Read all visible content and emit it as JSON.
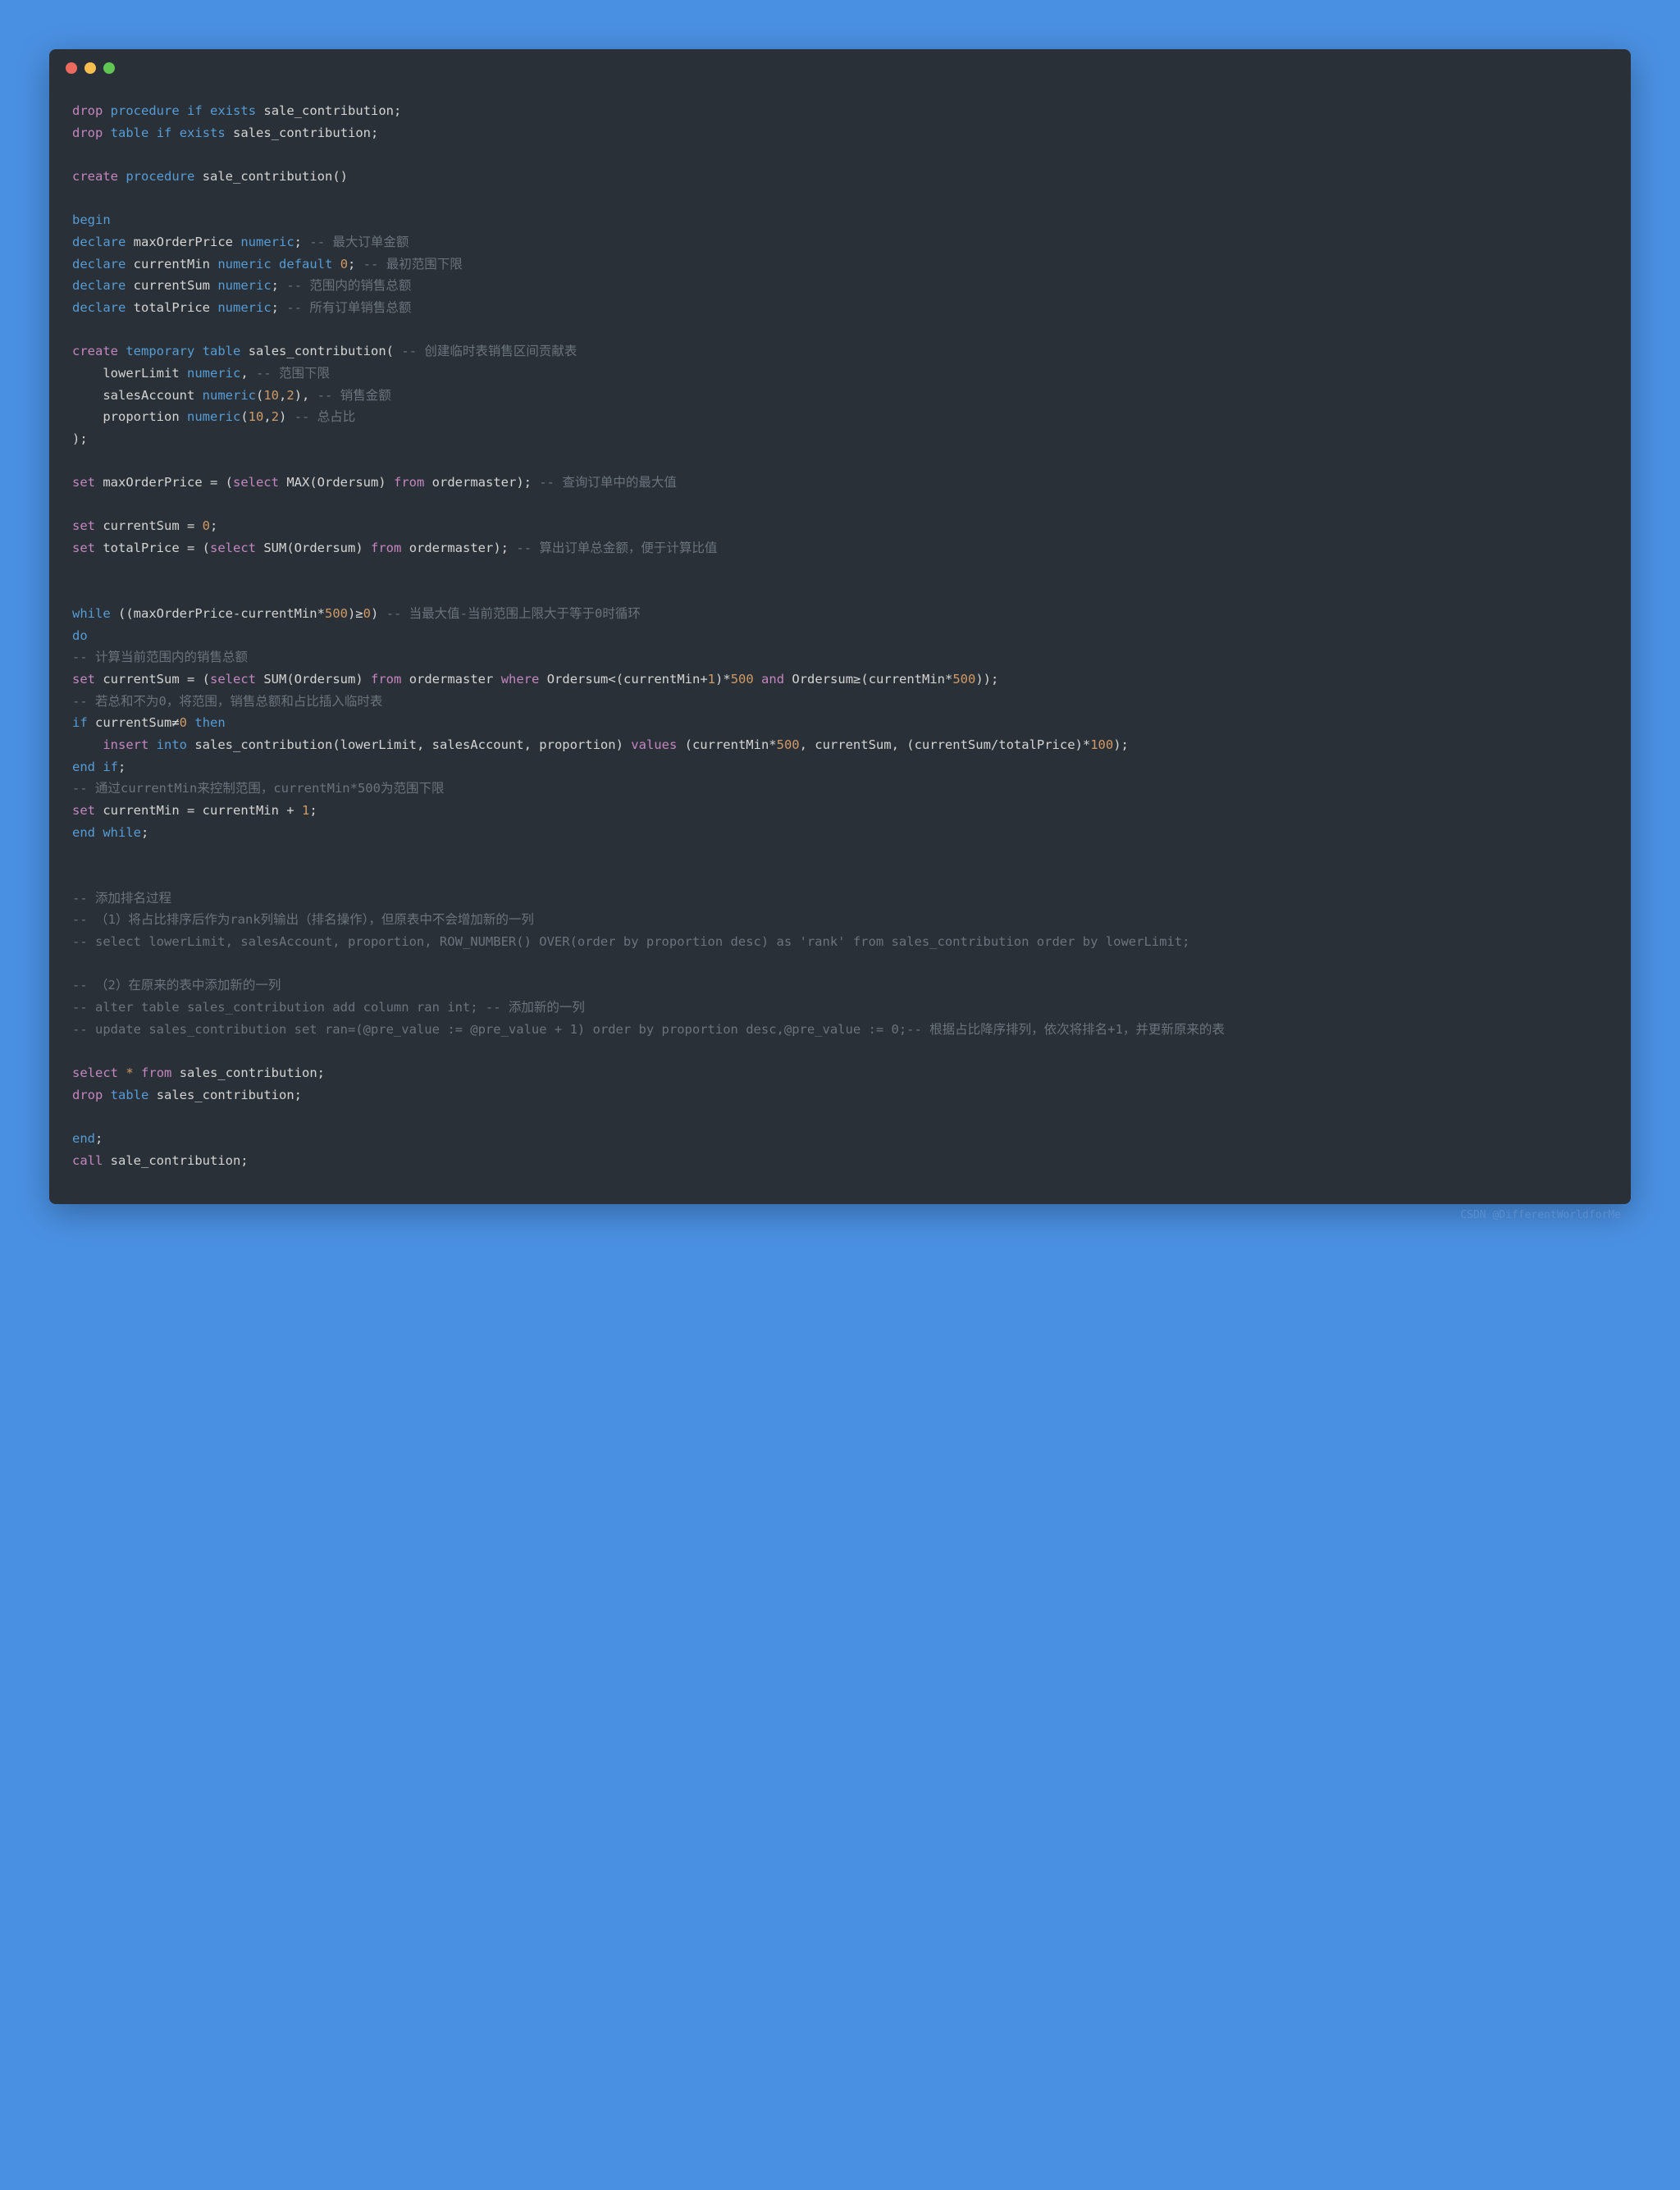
{
  "window": {
    "dots": [
      "red",
      "yellow",
      "green"
    ]
  },
  "footer": "CSDN @DifferentWorldforMe",
  "code": {
    "l1": {
      "a": "drop",
      "b": "procedure",
      "c": "if",
      "d": "exists",
      "e": "sale_contribution;"
    },
    "l2": {
      "a": "drop",
      "b": "table",
      "c": "if",
      "d": "exists",
      "e": "sales_contribution;"
    },
    "l3": {
      "a": "create",
      "b": "procedure",
      "c": "sale_contribution()"
    },
    "l4": "begin",
    "l5": {
      "a": "declare",
      "b": "maxOrderPrice",
      "c": "numeric",
      "d": ";",
      "cm": "-- 最大订单金额"
    },
    "l6": {
      "a": "declare",
      "b": "currentMin",
      "c": "numeric",
      "d": "default",
      "n": "0",
      "e": ";",
      "cm": "-- 最初范围下限"
    },
    "l7": {
      "a": "declare",
      "b": "currentSum",
      "c": "numeric",
      "d": ";",
      "cm": "-- 范围内的销售总额"
    },
    "l8": {
      "a": "declare",
      "b": "totalPrice",
      "c": "numeric",
      "d": ";",
      "cm": "-- 所有订单销售总额"
    },
    "l9": {
      "a": "create",
      "b": "temporary",
      "c": "table",
      "d": "sales_contribution(",
      "cm": "-- 创建临时表销售区间贡献表"
    },
    "l10": {
      "a": "lowerLimit",
      "b": "numeric",
      "c": ",",
      "cm": "-- 范围下限"
    },
    "l11": {
      "a": "salesAccount",
      "b": "numeric",
      "c": "(",
      "n1": "10",
      "d": ",",
      "n2": "2",
      "e": "),",
      "cm": "-- 销售金额"
    },
    "l12": {
      "a": "proportion",
      "b": "numeric",
      "c": "(",
      "n1": "10",
      "d": ",",
      "n2": "2",
      "e": ")",
      "cm": "-- 总占比"
    },
    "l13": ");",
    "l14": {
      "a": "set",
      "b": "maxOrderPrice = (",
      "c": "select",
      "d": "MAX(Ordersum)",
      "e": "from",
      "f": "ordermaster);",
      "cm": "-- 查询订单中的最大值"
    },
    "l15": {
      "a": "set",
      "b": "currentSum =",
      "n": "0",
      "c": ";"
    },
    "l16": {
      "a": "set",
      "b": "totalPrice = (",
      "c": "select",
      "d": "SUM(Ordersum)",
      "e": "from",
      "f": "ordermaster);",
      "cm": "-- 算出订单总金额，便于计算比值"
    },
    "l17": {
      "a": "while",
      "b": "((maxOrderPrice-currentMin*",
      "n": "500",
      "c": ")≥",
      "n2": "0",
      "d": ")",
      "cm": "-- 当最大值-当前范围上限大于等于0时循环"
    },
    "l18": "do",
    "l19": "-- 计算当前范围内的销售总额",
    "l20": {
      "a": "set",
      "b": "currentSum = (",
      "c": "select",
      "d": "SUM(Ordersum)",
      "e": "from",
      "f": "ordermaster",
      "g": "where",
      "h": "Ordersum<(currentMin+",
      "n1": "1",
      "i": ")*",
      "n2": "500",
      "j": "and",
      "k": "Ordersum≥(currentMin*",
      "n3": "500",
      "l": "));"
    },
    "l21": "-- 若总和不为0，将范围，销售总额和占比插入临时表",
    "l22": {
      "a": "if",
      "b": "currentSum≠",
      "n": "0",
      "c": "then"
    },
    "l23": {
      "a": "insert",
      "b": "into",
      "c": "sales_contribution(lowerLimit, salesAccount, proportion)",
      "d": "values",
      "e": "(currentMin*",
      "n1": "500",
      "f": ", currentSum, (currentSum/totalPrice)*",
      "n2": "100",
      "g": ");"
    },
    "l24": {
      "a": "end",
      "b": "if",
      "c": ";"
    },
    "l25": "-- 通过currentMin来控制范围，currentMin*500为范围下限",
    "l26": {
      "a": "set",
      "b": "currentMin = currentMin +",
      "n": "1",
      "c": ";"
    },
    "l27": {
      "a": "end",
      "b": "while",
      "c": ";"
    },
    "l28": "-- 添加排名过程",
    "l29": "-- （1）将占比排序后作为rank列输出（排名操作），但原表中不会增加新的一列",
    "l30": "-- select lowerLimit, salesAccount, proportion, ROW_NUMBER() OVER(order by proportion desc) as 'rank' from sales_contribution order by lowerLimit;",
    "l31": "-- （2）在原来的表中添加新的一列",
    "l32": "-- alter table sales_contribution add column ran int; -- 添加新的一列",
    "l33": "-- update sales_contribution set ran=(@pre_value := @pre_value + 1) order by proportion desc,@pre_value := 0;-- 根据占比降序排列，依次将排名+1，并更新原来的表",
    "l34": {
      "a": "select",
      "b": "*",
      "c": "from",
      "d": "sales_contribution;"
    },
    "l35": {
      "a": "drop",
      "b": "table",
      "c": "sales_contribution;"
    },
    "l36": {
      "a": "end",
      "b": ";"
    },
    "l37": {
      "a": "call",
      "b": "sale_contribution;"
    }
  }
}
